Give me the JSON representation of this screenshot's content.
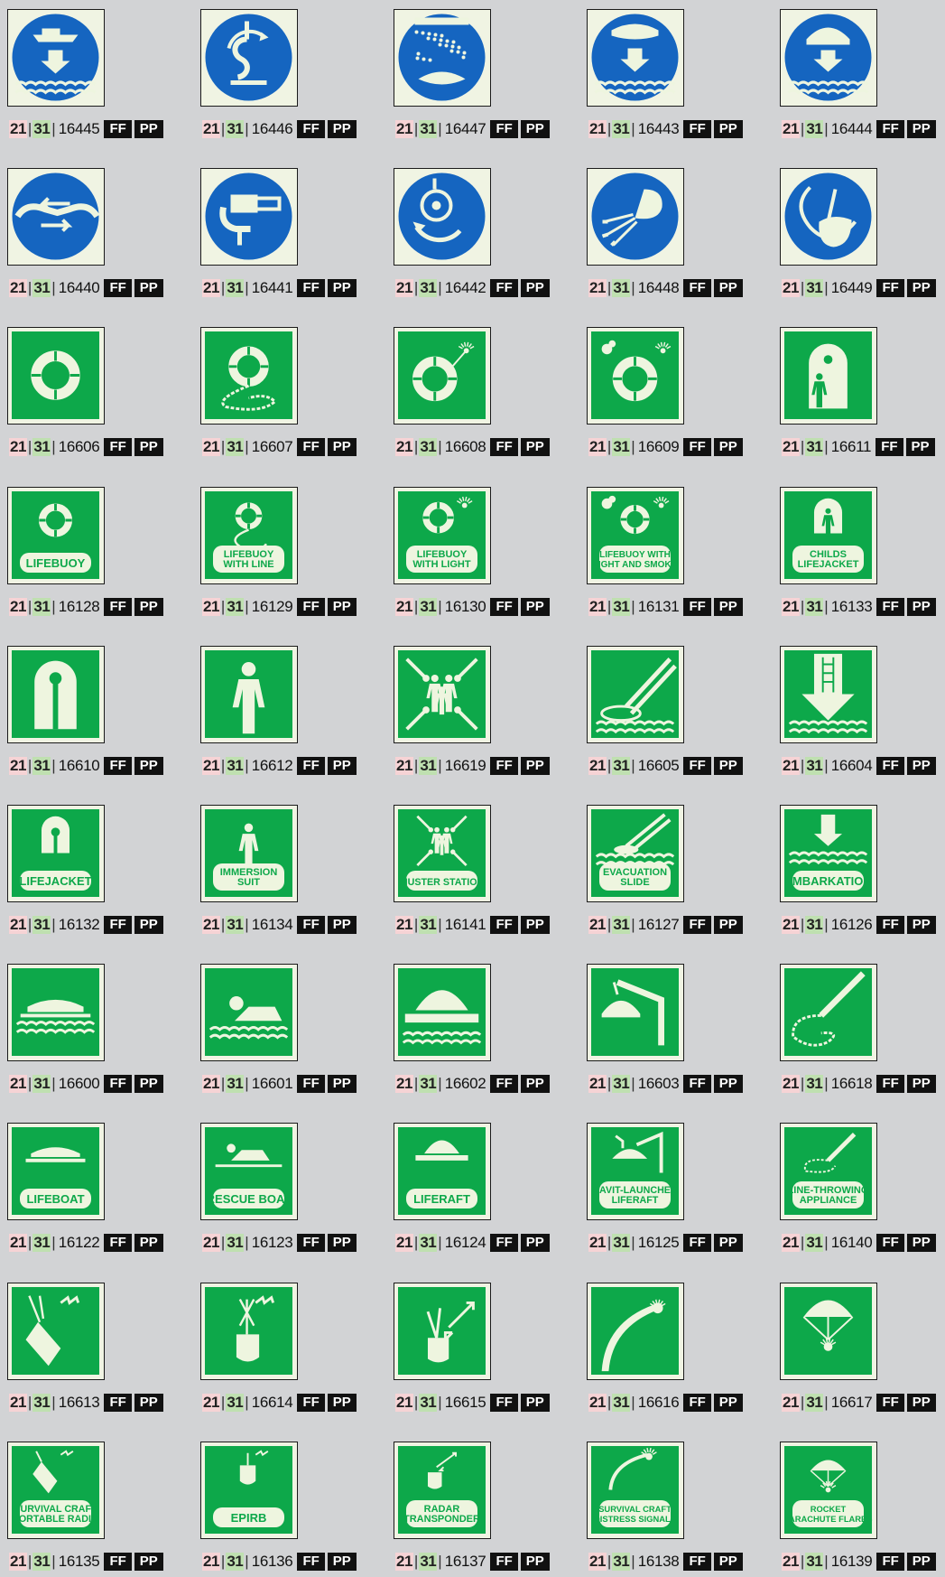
{
  "prefix_a": "21",
  "prefix_b": "31",
  "tags": [
    "FF",
    "PP"
  ],
  "colors": {
    "mandatory_blue": "#1565c0",
    "safety_green": "#0da84a",
    "photoluminescent": "#eef5df",
    "background": "#d2d3d5"
  },
  "signs": [
    {
      "code": "16445",
      "kind": "blue",
      "icon": "launch-boat-icon",
      "label": ""
    },
    {
      "code": "16446",
      "kind": "blue",
      "icon": "release-hook-icon",
      "label": ""
    },
    {
      "code": "16447",
      "kind": "blue",
      "icon": "water-spray-icon",
      "label": ""
    },
    {
      "code": "16443",
      "kind": "blue",
      "icon": "launch-liferaft-icon",
      "label": ""
    },
    {
      "code": "16444",
      "kind": "blue",
      "icon": "launch-davit-liferaft-icon",
      "label": ""
    },
    {
      "code": "16440",
      "kind": "blue",
      "icon": "secure-gripes-icon",
      "label": ""
    },
    {
      "code": "16441",
      "kind": "blue",
      "icon": "start-engine-icon",
      "label": ""
    },
    {
      "code": "16442",
      "kind": "blue",
      "icon": "lower-lifeboat-icon",
      "label": ""
    },
    {
      "code": "16448",
      "kind": "blue",
      "icon": "inflate-liferaft-icon",
      "label": ""
    },
    {
      "code": "16449",
      "kind": "blue",
      "icon": "cut-painter-icon",
      "label": ""
    },
    {
      "code": "16606",
      "kind": "green",
      "icon": "lifebuoy-icon",
      "label": ""
    },
    {
      "code": "16607",
      "kind": "green",
      "icon": "lifebuoy-line-icon",
      "label": ""
    },
    {
      "code": "16608",
      "kind": "green",
      "icon": "lifebuoy-light-icon",
      "label": ""
    },
    {
      "code": "16609",
      "kind": "green",
      "icon": "lifebuoy-light-smoke-icon",
      "label": ""
    },
    {
      "code": "16611",
      "kind": "green",
      "icon": "childs-lifejacket-icon",
      "label": ""
    },
    {
      "code": "16128",
      "kind": "green",
      "icon": "lifebuoy-icon",
      "label": "LIFEBUOY"
    },
    {
      "code": "16129",
      "kind": "green",
      "icon": "lifebuoy-line-icon",
      "label": "LIFEBUOY\nWITH LINE"
    },
    {
      "code": "16130",
      "kind": "green",
      "icon": "lifebuoy-light-icon",
      "label": "LIFEBUOY\nWITH LIGHT"
    },
    {
      "code": "16131",
      "kind": "green",
      "icon": "lifebuoy-light-smoke-icon",
      "label": "LIFEBUOY WITH\nLIGHT AND SMOKE"
    },
    {
      "code": "16133",
      "kind": "green",
      "icon": "childs-lifejacket-icon",
      "label": "CHILDS\nLIFEJACKET"
    },
    {
      "code": "16610",
      "kind": "green",
      "icon": "lifejacket-icon",
      "label": ""
    },
    {
      "code": "16612",
      "kind": "green",
      "icon": "immersion-suit-icon",
      "label": ""
    },
    {
      "code": "16619",
      "kind": "green",
      "icon": "muster-station-icon",
      "label": ""
    },
    {
      "code": "16605",
      "kind": "green",
      "icon": "evacuation-slide-icon",
      "label": ""
    },
    {
      "code": "16604",
      "kind": "green",
      "icon": "embarkation-ladder-icon",
      "label": ""
    },
    {
      "code": "16132",
      "kind": "green",
      "icon": "lifejacket-icon",
      "label": "LIFEJACKET"
    },
    {
      "code": "16134",
      "kind": "green",
      "icon": "immersion-suit-icon",
      "label": "IMMERSION\nSUIT"
    },
    {
      "code": "16141",
      "kind": "green",
      "icon": "muster-station-icon",
      "label": "MUSTER STATION"
    },
    {
      "code": "16127",
      "kind": "green",
      "icon": "evacuation-slide-icon",
      "label": "EVACUATION\nSLIDE"
    },
    {
      "code": "16126",
      "kind": "green",
      "icon": "embarkation-ladder-icon",
      "label": "EMBARKATION"
    },
    {
      "code": "16600",
      "kind": "green",
      "icon": "lifeboat-icon",
      "label": ""
    },
    {
      "code": "16601",
      "kind": "green",
      "icon": "rescue-boat-icon",
      "label": ""
    },
    {
      "code": "16602",
      "kind": "green",
      "icon": "liferaft-icon",
      "label": ""
    },
    {
      "code": "16603",
      "kind": "green",
      "icon": "davit-liferaft-icon",
      "label": ""
    },
    {
      "code": "16618",
      "kind": "green",
      "icon": "line-throwing-icon",
      "label": ""
    },
    {
      "code": "16122",
      "kind": "green",
      "icon": "lifeboat-icon",
      "label": "LIFEBOAT"
    },
    {
      "code": "16123",
      "kind": "green",
      "icon": "rescue-boat-icon",
      "label": "RESCUE BOAT"
    },
    {
      "code": "16124",
      "kind": "green",
      "icon": "liferaft-icon",
      "label": "LIFERAFT"
    },
    {
      "code": "16125",
      "kind": "green",
      "icon": "davit-liferaft-icon",
      "label": "DAVIT-LAUNCHED\nLIFERAFT"
    },
    {
      "code": "16140",
      "kind": "green",
      "icon": "line-throwing-icon",
      "label": "LINE-THROWING\nAPPLIANCE"
    },
    {
      "code": "16613",
      "kind": "green",
      "icon": "portable-radio-icon",
      "label": ""
    },
    {
      "code": "16614",
      "kind": "green",
      "icon": "epirb-icon",
      "label": ""
    },
    {
      "code": "16615",
      "kind": "green",
      "icon": "radar-transponder-icon",
      "label": ""
    },
    {
      "code": "16616",
      "kind": "green",
      "icon": "distress-signal-icon",
      "label": ""
    },
    {
      "code": "16617",
      "kind": "green",
      "icon": "parachute-flare-icon",
      "label": ""
    },
    {
      "code": "16135",
      "kind": "green",
      "icon": "portable-radio-icon",
      "label": "SURVIVAL CRAFT\nPORTABLE RADIO"
    },
    {
      "code": "16136",
      "kind": "green",
      "icon": "epirb-icon",
      "label": "EPIRB"
    },
    {
      "code": "16137",
      "kind": "green",
      "icon": "radar-transponder-icon",
      "label": "RADAR\nTRANSPONDER"
    },
    {
      "code": "16138",
      "kind": "green",
      "icon": "distress-signal-icon",
      "label": "SURVIVAL CRAFT\nDISTRESS SIGNALS"
    },
    {
      "code": "16139",
      "kind": "green",
      "icon": "parachute-flare-icon",
      "label": "ROCKET\nPARACHUTE FLARES"
    }
  ]
}
